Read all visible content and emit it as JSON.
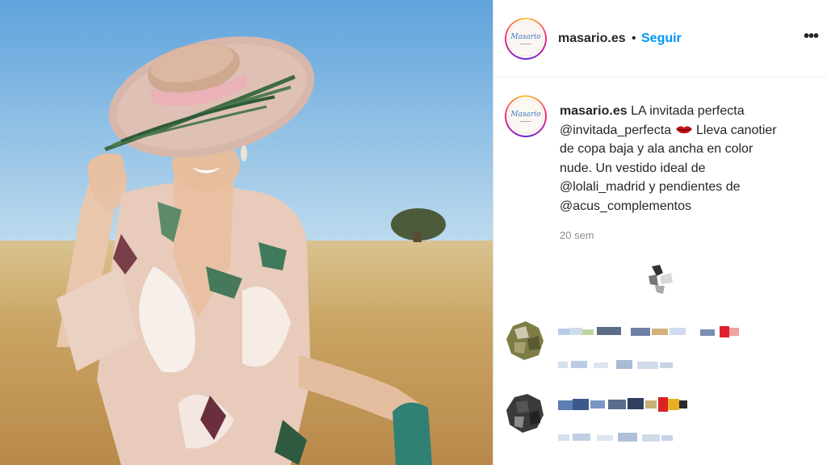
{
  "post": {
    "username": "masario.es",
    "separator": "•",
    "follow_label": "Seguir",
    "more_label": "•••",
    "avatar_logo": "Masario",
    "caption": {
      "username": "masario.es",
      "line1": "LA invitada perfecta",
      "line2_mention": "@invitada_perfecta",
      "line2_rest": "Lleva canotier",
      "line3": "de copa baja y ala ancha en color",
      "line4": "nude. Un vestido ideal de",
      "line5": "@lolali_madrid y pendientes de",
      "line6": "@acus_complementos"
    },
    "timestamp": "20 sem"
  },
  "icons": {
    "emoji": "red-lips-icon",
    "more": "ellipsis-icon"
  },
  "colors": {
    "link": "#0095f6",
    "text": "#262626",
    "muted": "#8e8e8e",
    "ring": "#ee2a7b"
  }
}
